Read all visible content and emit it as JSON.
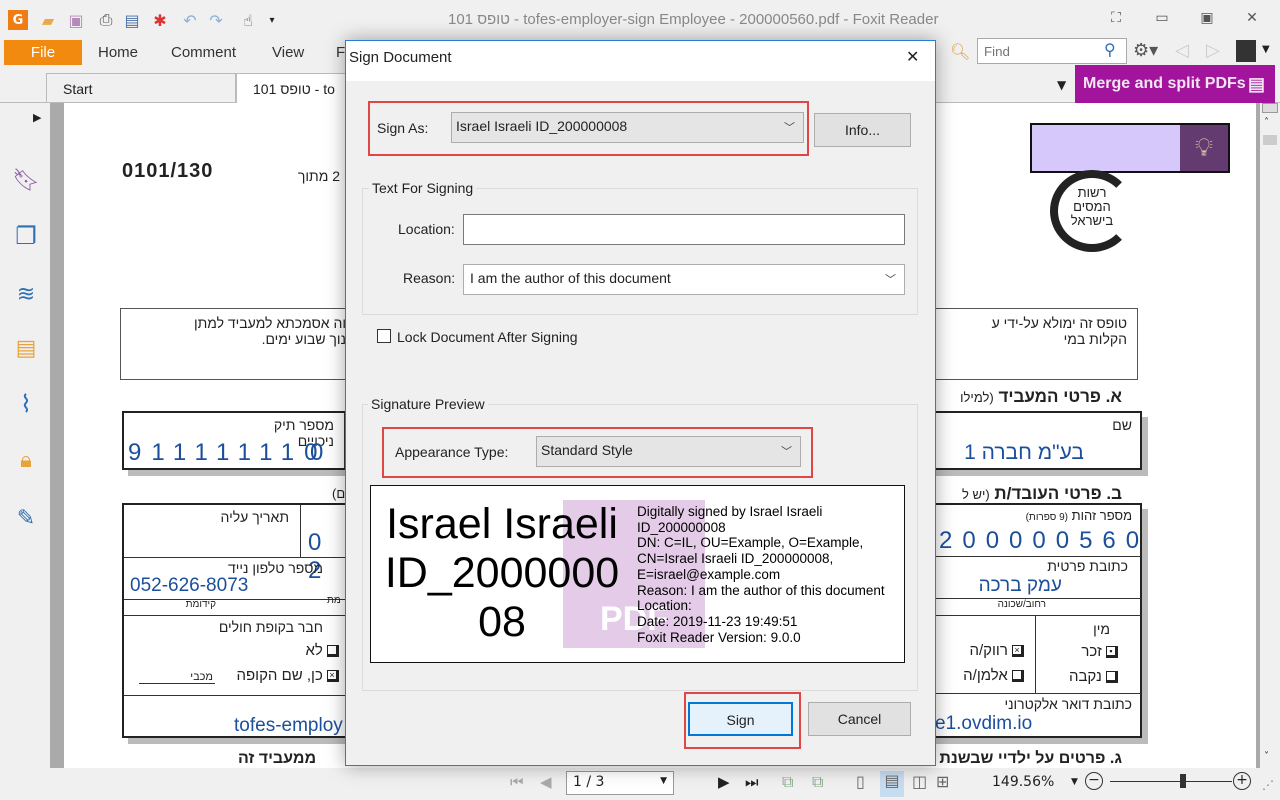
{
  "window": {
    "title": "101 טופס - tofes-employer-sign Employee - 200000560.pdf - Foxit Reader"
  },
  "quick_access": [
    "foxit-logo-icon",
    "open-icon",
    "save-icon",
    "print-icon",
    "properties-icon",
    "new-icon",
    "undo-icon",
    "redo-icon",
    "hand-tool-icon",
    "customize-icon"
  ],
  "ribbon": {
    "file": "File",
    "tabs": [
      "Home",
      "Comment",
      "View",
      "F"
    ],
    "find_placeholder": "Find"
  },
  "banner": {
    "label": "Merge and split PDFs",
    "color": "#a2149c"
  },
  "doc_tabs": [
    {
      "label": "Start"
    },
    {
      "label": "101 טופס - to"
    }
  ],
  "sidebar": [
    "bookmarks-icon",
    "pages-icon",
    "layers-icon",
    "comments-icon",
    "attachments-icon",
    "security-icon",
    "signatures-icon"
  ],
  "document": {
    "form_no": "0101/130",
    "page_of": "2 מתוך",
    "logo": [
      "רשות",
      "המסים",
      "בישראל"
    ],
    "intro_left": [
      "וה אסמכתא למעביד למתן",
      "נוך שבוע ימים."
    ],
    "intro_right": [
      "טופס זה ימולא על-ידי ע",
      "הקלות במי"
    ],
    "section_a": "א. פרטי המעביד",
    "section_a_note": "(למילו",
    "tik_label": "מספר תיק ניכויים",
    "tik_digits": "911111110",
    "tik_extra": "0",
    "name_label": "שם",
    "name_value": "בע\"מ חברה 1",
    "section_b": "ב. פרטי העובד/ת",
    "section_b_note": "(יש ל",
    "left_paren": "(ם",
    "aliya_label": "תאריך עליה",
    "aliya_partial": "0 2",
    "phone_label": "מספר טלפון נייד",
    "phone_value": "052-626-8073",
    "prefix_label": "קידומת",
    "partial_label": "מת",
    "kupa_label": "חבר בקופת חולים",
    "kupa_no": "לא",
    "kupa_yes": "כן, שם הקופה",
    "kupa_name": "מכבי",
    "email_partial_left": "tofes-employ",
    "id_label": "מספר זהות",
    "id_note": "(9 ספרות)",
    "id_digits": "200000560",
    "address_label": "כתובת פרטית",
    "address_value": "עמק ברכה",
    "street_label": "רחוב/שכונה",
    "gender_label": "מין",
    "male": "זכר",
    "female": "נקבה",
    "single": "רווק/ה",
    "widow": "אלמן/ה",
    "email_label": "כתובת דואר אלקטרוני",
    "email_partial_right": "e1.ovdim.io",
    "section_c": "ג. פרטים על ילדיי שבשנת המ",
    "section_d": "ממעביד זה"
  },
  "dialog": {
    "title": "Sign Document",
    "sign_as_label": "Sign As:",
    "sign_as_value": "Israel Israeli ID_200000008",
    "info_button": "Info...",
    "text_group": "Text For Signing",
    "location_label": "Location:",
    "location_value": "",
    "reason_label": "Reason:",
    "reason_value": "I am the author of this document",
    "lock_label": "Lock Document After Signing",
    "lock_checked": false,
    "preview_group": "Signature Preview",
    "appearance_label": "Appearance Type:",
    "appearance_value": "Standard Style",
    "preview": {
      "name_lines": [
        "Israel Israeli",
        "ID_2000000",
        "08"
      ],
      "details": [
        "Digitally signed by Israel Israeli",
        "ID_200000008",
        "DN: C=IL, OU=Example, O=Example,",
        "CN=Israel Israeli ID_200000008,",
        "E=israel@example.com",
        "Reason: I am the author of this document",
        "Location:",
        "Date: 2019-11-23 19:49:51",
        "Foxit Reader Version: 9.0.0"
      ],
      "watermark": "PDF"
    },
    "sign_button": "Sign",
    "cancel_button": "Cancel",
    "highlight_color": "#e04646"
  },
  "statusbar": {
    "page": "1 / 3",
    "zoom": "149.56%",
    "zoom_slider_level": 0.6
  }
}
